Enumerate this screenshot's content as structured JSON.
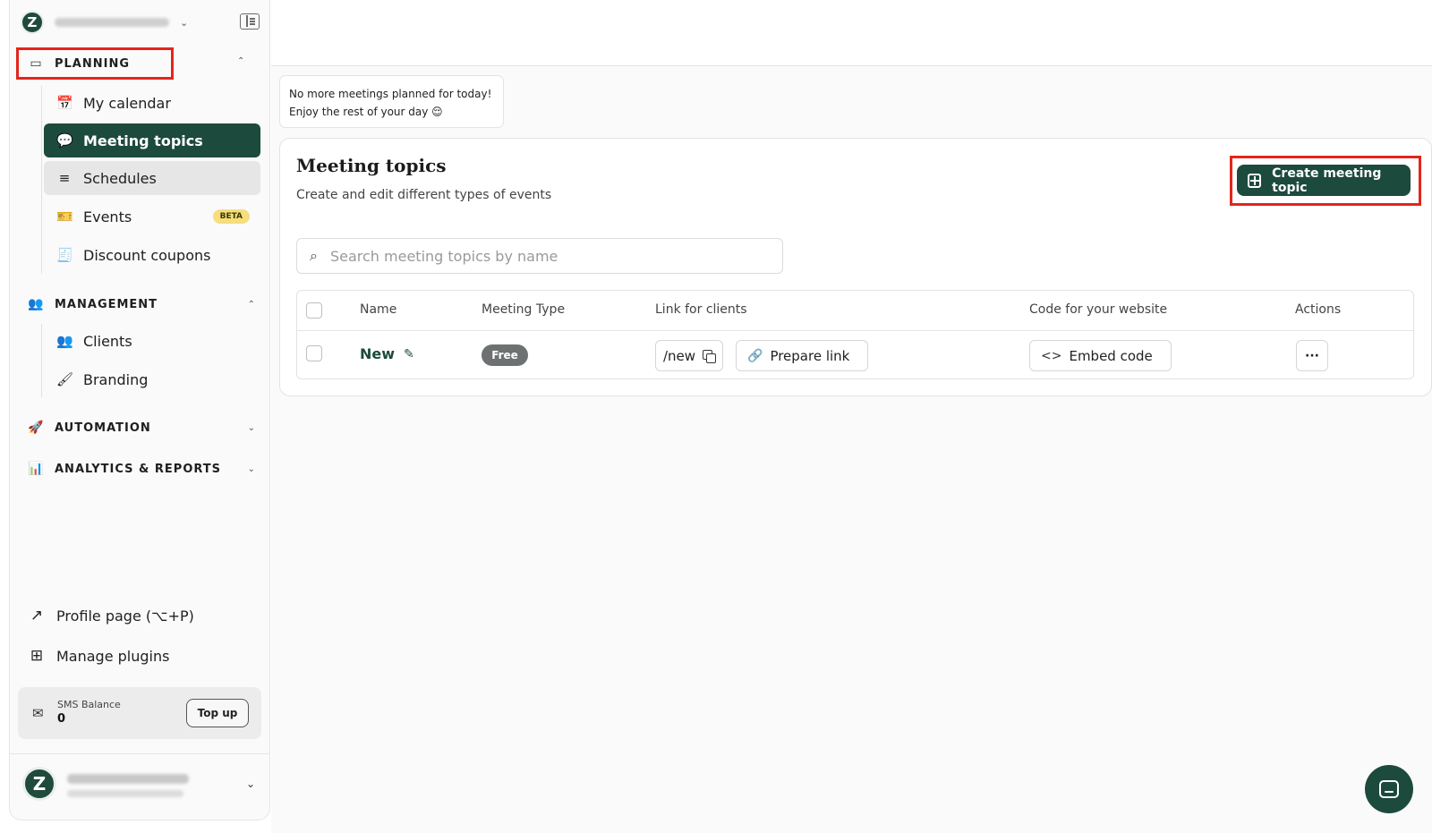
{
  "sidebar": {
    "logo_letter": "Z",
    "sections": {
      "planning": {
        "label": "PLANNING"
      },
      "management": {
        "label": "MANAGEMENT"
      },
      "automation": {
        "label": "AUTOMATION"
      },
      "analytics": {
        "label": "ANALYTICS & REPORTS"
      }
    },
    "planning_items": [
      {
        "label": "My calendar",
        "icon": "calendar-icon"
      },
      {
        "label": "Meeting topics",
        "icon": "chat-bubbles-icon",
        "active": true
      },
      {
        "label": "Schedules",
        "icon": "list-icon"
      },
      {
        "label": "Events",
        "icon": "ticket-icon",
        "badge": "BETA"
      },
      {
        "label": "Discount coupons",
        "icon": "coupon-icon"
      }
    ],
    "management_items": [
      {
        "label": "Clients",
        "icon": "users-icon"
      },
      {
        "label": "Branding",
        "icon": "brush-icon"
      }
    ],
    "bottom_links": [
      {
        "label": "Profile page (⌥+P)",
        "icon": "external-link-icon"
      },
      {
        "label": "Manage plugins",
        "icon": "plugins-icon"
      }
    ],
    "sms": {
      "title": "SMS Balance",
      "value": "0",
      "topup_label": "Top up"
    }
  },
  "toast": {
    "line1": "No more meetings planned for today!",
    "line2": "Enjoy the rest of your day 😌"
  },
  "main": {
    "title": "Meeting topics",
    "subtitle": "Create and edit different types of events",
    "create_label": "Create meeting topic",
    "search_placeholder": "Search meeting topics by name",
    "table": {
      "headers": [
        "Name",
        "Meeting Type",
        "Link for clients",
        "Code for your website",
        "Actions"
      ],
      "rows": [
        {
          "name": "New",
          "type": "Free",
          "link": "/new",
          "prepare": "Prepare link",
          "embed": "Embed code",
          "more": "···"
        }
      ]
    }
  },
  "colors": {
    "brand": "#1c4a3c",
    "highlight": "#e2261c",
    "beta": "#f6dd7d"
  }
}
